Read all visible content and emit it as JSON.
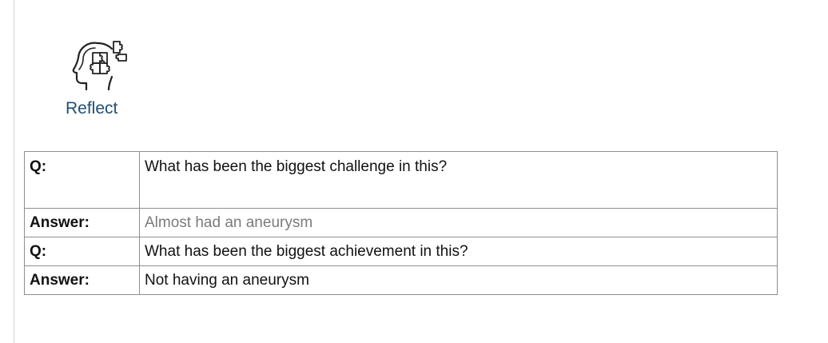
{
  "section": {
    "title": "Reflect",
    "icon": "head-puzzle-icon",
    "accent_color": "#1f4e79"
  },
  "qa_table": {
    "rows": [
      {
        "label": "Q:",
        "text": "What has been the biggest challenge in this?"
      },
      {
        "label": "Answer:",
        "text": "Almost had an aneurysm"
      },
      {
        "label": "Q:",
        "text": "What has been the biggest achievement in this?"
      },
      {
        "label": "Answer:",
        "text": "Not having an aneurysm"
      }
    ]
  }
}
